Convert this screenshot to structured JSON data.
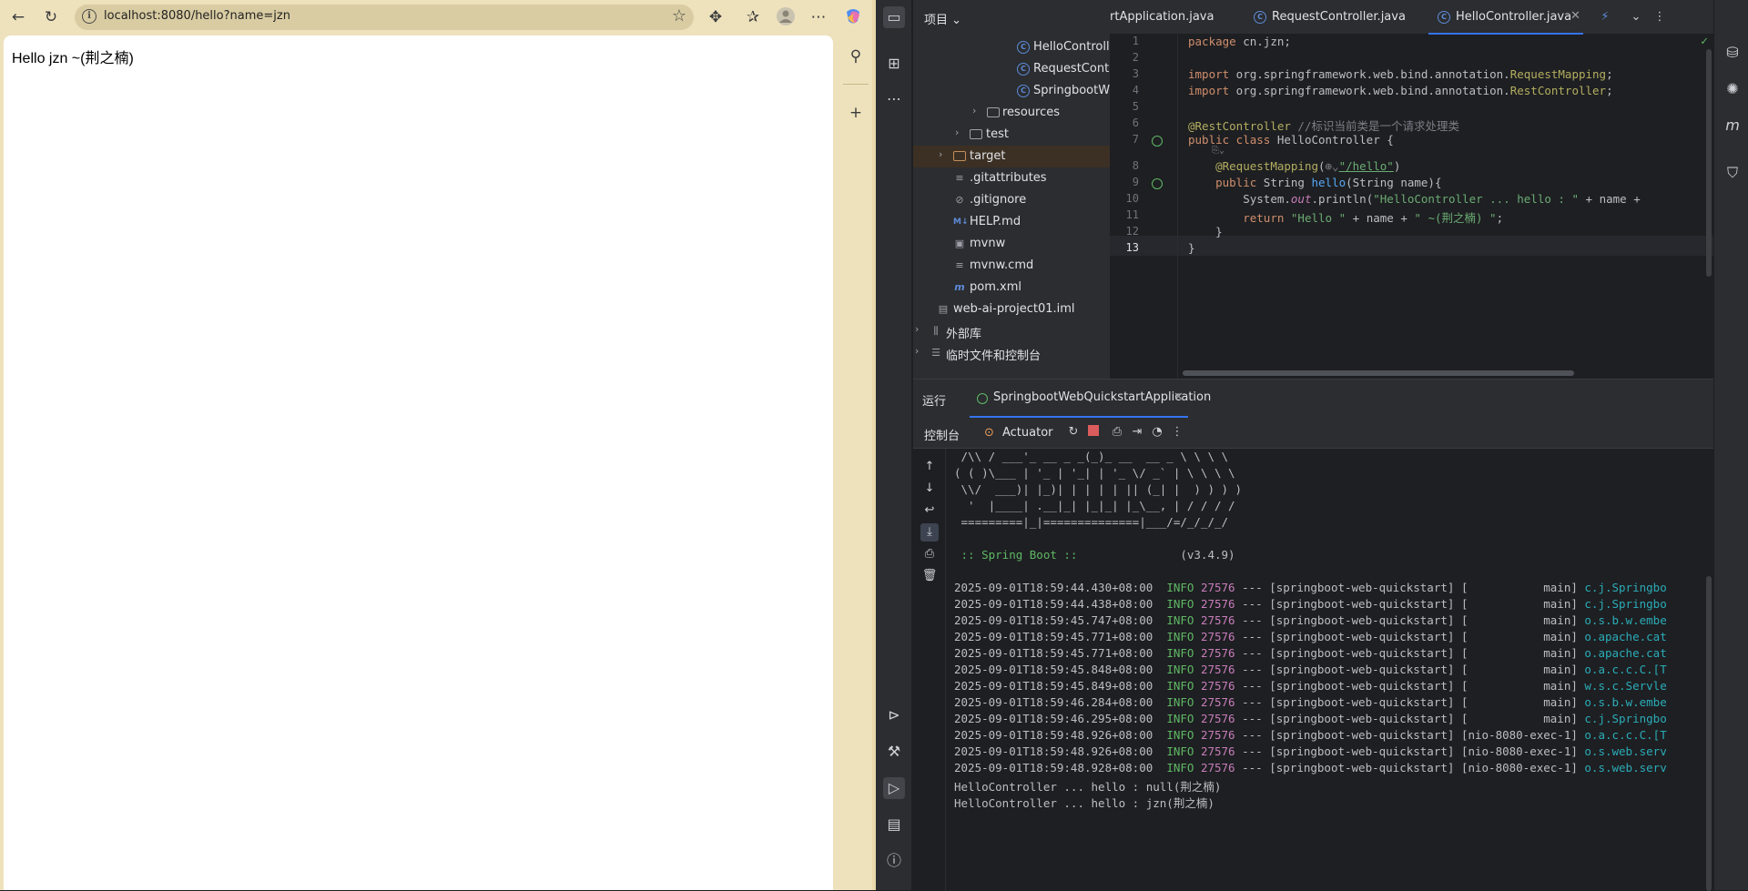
{
  "browser": {
    "url": "localhost:8080/hello?name=jzn",
    "page_text": "Hello jzn ~(荆之楠)",
    "icons": [
      "back-arrow-icon",
      "reload-icon",
      "info-icon",
      "star-icon",
      "extensions-icon",
      "favorites-icon",
      "profile-icon",
      "more-icon",
      "copilot-icon",
      "search-icon",
      "add-icon"
    ]
  },
  "ide": {
    "project_label": "项目",
    "tabs": [
      {
        "label": "rtApplication.java"
      },
      {
        "label": "RequestController.java"
      },
      {
        "label": "HelloController.java"
      }
    ],
    "tree": [
      {
        "label": "HelloController",
        "type": "class"
      },
      {
        "label": "RequestControll",
        "type": "class"
      },
      {
        "label": "SpringbootWeb",
        "type": "class"
      },
      {
        "label": "resources",
        "type": "folder"
      },
      {
        "label": "test",
        "type": "folder"
      },
      {
        "label": "target",
        "type": "folder"
      },
      {
        "label": ".gitattributes",
        "type": "file"
      },
      {
        "label": ".gitignore",
        "type": "file"
      },
      {
        "label": "HELP.md",
        "type": "md"
      },
      {
        "label": "mvnw",
        "type": "file"
      },
      {
        "label": "mvnw.cmd",
        "type": "file"
      },
      {
        "label": "pom.xml",
        "type": "maven"
      },
      {
        "label": "web-ai-project01.iml",
        "type": "file"
      },
      {
        "label": "外部库",
        "type": "lib"
      },
      {
        "label": "临时文件和控制台",
        "type": "scratch"
      }
    ],
    "line_numbers": [
      "1",
      "2",
      "3",
      "4",
      "5",
      "6",
      "7",
      "",
      "8",
      "9",
      "10",
      "11",
      "12",
      "13"
    ],
    "code": {
      "l1_kw": "package",
      "l1_rest": " cn.jzn;",
      "l3_kw": "import",
      "l3_pkg": " org.springframework.web.bind.annotation.",
      "l3_cls": "RequestMapping",
      "l3_end": ";",
      "l4_kw": "import",
      "l4_pkg": " org.springframework.web.bind.annotation.",
      "l4_cls": "RestController",
      "l4_end": ";",
      "l6_an": "@RestController",
      "l6_cm": " //标识当前类是一个请求处理类",
      "l7_kw": "public class",
      "l7_rest": " HelloController {",
      "l7b_hint": "⎘⌄",
      "l8_an": "@RequestMapping",
      "l8_p1": "(",
      "l8_hint": "⊕⌄",
      "l8_str": "\"/hello\"",
      "l8_p2": ")",
      "l9_kw": "public",
      "l9_type": " String ",
      "l9_fn": "hello",
      "l9_args": "(String name){",
      "l10_a": "System.",
      "l10_out": "out",
      "l10_b": ".println(",
      "l10_str": "\"HelloController ... hello : \"",
      "l10_c": " + name + ",
      "l11_kw": "return",
      "l11_s1": "\"Hello \"",
      "l11_mid": " + name + ",
      "l11_s2": "\" ~(荆之楠) \"",
      "l11_end": ";",
      "l12": "}",
      "l13": "}"
    },
    "run": {
      "header": "运行",
      "tab_label": "SpringbootWebQuickstartApplication",
      "console_label": "控制台",
      "actuator_label": "Actuator"
    },
    "console": {
      "banner": [
        " /\\\\ / ___'_ __ _ _(_)_ __  __ _ \\ \\ \\ \\",
        "( ( )\\___ | '_ | '_| | '_ \\/ _` | \\ \\ \\ \\",
        " \\\\/  ___)| |_)| | | | | || (_| |  ) ) ) )",
        "  '  |____| .__|_| |_|_| |_\\__, | / / / /",
        " =========|_|==============|___/=/_/_/_/"
      ],
      "spring_label": " :: Spring Boot ::",
      "spring_version": "(v3.4.9)",
      "logs": [
        {
          "ts": "2025-09-01T18:59:44.430+08:00",
          "lvl": "INFO",
          "pid": "27576",
          "mid": " --- [springboot-web-quickstart] [           main] ",
          "src": "c.j.Springbo"
        },
        {
          "ts": "2025-09-01T18:59:44.438+08:00",
          "lvl": "INFO",
          "pid": "27576",
          "mid": " --- [springboot-web-quickstart] [           main] ",
          "src": "c.j.Springbo"
        },
        {
          "ts": "2025-09-01T18:59:45.747+08:00",
          "lvl": "INFO",
          "pid": "27576",
          "mid": " --- [springboot-web-quickstart] [           main] ",
          "src": "o.s.b.w.embe"
        },
        {
          "ts": "2025-09-01T18:59:45.771+08:00",
          "lvl": "INFO",
          "pid": "27576",
          "mid": " --- [springboot-web-quickstart] [           main] ",
          "src": "o.apache.cat"
        },
        {
          "ts": "2025-09-01T18:59:45.771+08:00",
          "lvl": "INFO",
          "pid": "27576",
          "mid": " --- [springboot-web-quickstart] [           main] ",
          "src": "o.apache.cat"
        },
        {
          "ts": "2025-09-01T18:59:45.848+08:00",
          "lvl": "INFO",
          "pid": "27576",
          "mid": " --- [springboot-web-quickstart] [           main] ",
          "src": "o.a.c.c.C.[T"
        },
        {
          "ts": "2025-09-01T18:59:45.849+08:00",
          "lvl": "INFO",
          "pid": "27576",
          "mid": " --- [springboot-web-quickstart] [           main] ",
          "src": "w.s.c.Servle"
        },
        {
          "ts": "2025-09-01T18:59:46.284+08:00",
          "lvl": "INFO",
          "pid": "27576",
          "mid": " --- [springboot-web-quickstart] [           main] ",
          "src": "o.s.b.w.embe"
        },
        {
          "ts": "2025-09-01T18:59:46.295+08:00",
          "lvl": "INFO",
          "pid": "27576",
          "mid": " --- [springboot-web-quickstart] [           main] ",
          "src": "c.j.Springbo"
        },
        {
          "ts": "2025-09-01T18:59:48.926+08:00",
          "lvl": "INFO",
          "pid": "27576",
          "mid": " --- [springboot-web-quickstart] [nio-8080-exec-1] ",
          "src": "o.a.c.c.C.[T"
        },
        {
          "ts": "2025-09-01T18:59:48.926+08:00",
          "lvl": "INFO",
          "pid": "27576",
          "mid": " --- [springboot-web-quickstart] [nio-8080-exec-1] ",
          "src": "o.s.web.serv"
        },
        {
          "ts": "2025-09-01T18:59:48.928+08:00",
          "lvl": "INFO",
          "pid": "27576",
          "mid": " --- [springboot-web-quickstart] [nio-8080-exec-1] ",
          "src": "o.s.web.serv"
        }
      ],
      "output": [
        "HelloController ... hello : null(荆之楠)",
        "HelloController ... hello : jzn(荆之楠)"
      ]
    },
    "colors": {
      "accent": "#3574f0",
      "info": "#5fb865",
      "pid": "#c77dbb",
      "logger": "#2aacb8"
    }
  }
}
